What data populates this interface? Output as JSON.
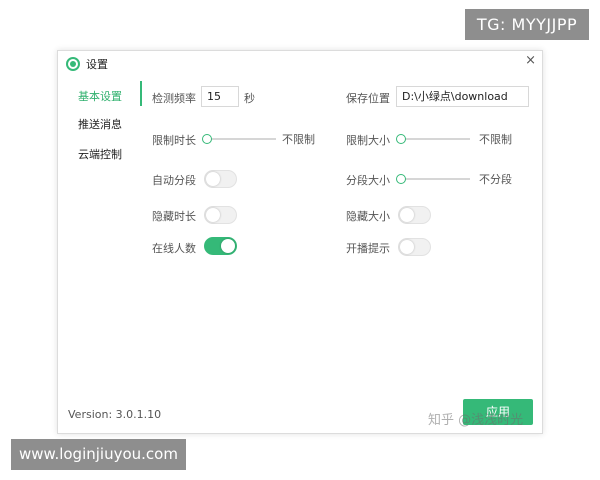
{
  "watermarks": {
    "top_right": "TG: MYYJJPP",
    "bottom_left": "www.loginjiuyou.com",
    "overlay": "知乎 @浅浅时光"
  },
  "window": {
    "title": "设置",
    "close_glyph": "×",
    "accent_color": "#35b978"
  },
  "nav": {
    "items": [
      {
        "label": "基本设置",
        "active": true
      },
      {
        "label": "推送消息",
        "active": false
      },
      {
        "label": "云端控制",
        "active": false
      }
    ]
  },
  "settings": {
    "detect_freq": {
      "label": "检测频率",
      "value": "15",
      "unit": "秒"
    },
    "save_location": {
      "label": "保存位置",
      "value": "D:\\小绿点\\download"
    },
    "limit_duration": {
      "label": "限制时长",
      "value_text": "不限制",
      "level": 0
    },
    "limit_size": {
      "label": "限制大小",
      "value_text": "不限制",
      "level": 0
    },
    "auto_segment": {
      "label": "自动分段",
      "on": false
    },
    "segment_size": {
      "label": "分段大小",
      "value_text": "不分段",
      "level": 0
    },
    "hide_duration": {
      "label": "隐藏时长",
      "on": false
    },
    "hide_size": {
      "label": "隐藏大小",
      "on": false
    },
    "online_count": {
      "label": "在线人数",
      "on": true
    },
    "start_prompt": {
      "label": "开播提示",
      "on": false
    }
  },
  "footer": {
    "version": "Version:  3.0.1.10",
    "apply_label": "应用"
  }
}
